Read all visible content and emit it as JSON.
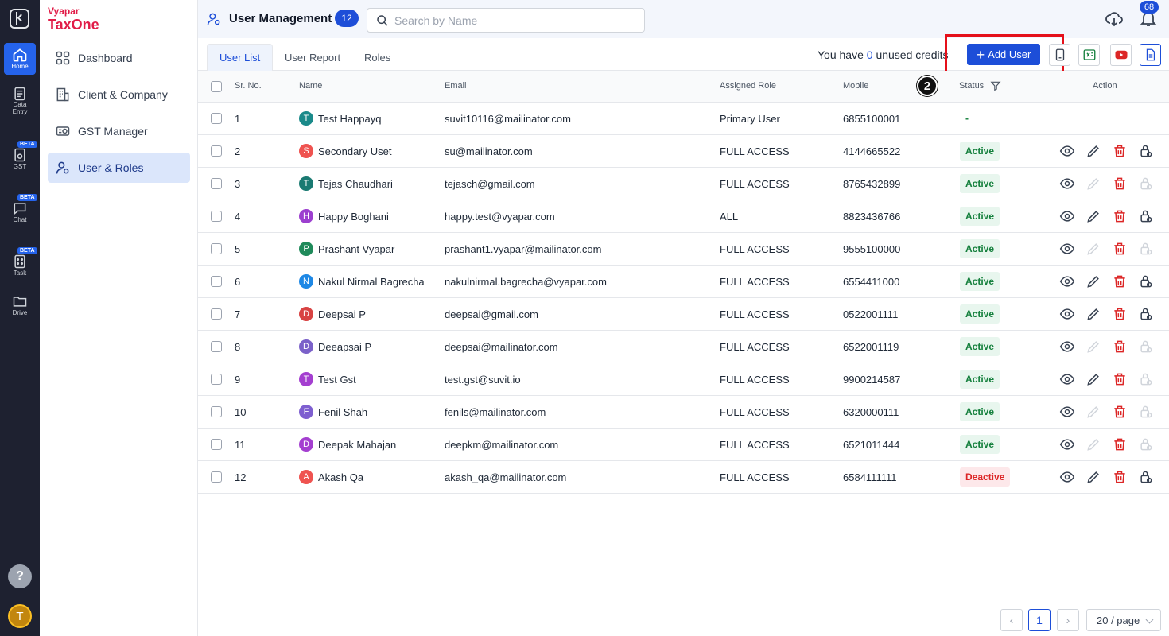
{
  "rail": {
    "items": [
      {
        "label": "Home",
        "icon": "home-icon"
      },
      {
        "label": "Data Entry",
        "icon": "data-entry-icon"
      },
      {
        "label": "GST",
        "icon": "gst-icon",
        "badge": "BETA"
      },
      {
        "label": "Chat",
        "icon": "chat-icon",
        "badge": "BETA"
      },
      {
        "label": "Task",
        "icon": "task-icon",
        "badge": "BETA"
      },
      {
        "label": "Drive",
        "icon": "drive-icon"
      }
    ],
    "help_label": "?",
    "user_initial": "T"
  },
  "logo": {
    "line1": "Vyapar",
    "line2": "TaxOne"
  },
  "sidebar": {
    "items": [
      {
        "label": "Dashboard"
      },
      {
        "label": "Client & Company"
      },
      {
        "label": "GST Manager"
      },
      {
        "label": "User & Roles"
      }
    ]
  },
  "header": {
    "title": "User Management",
    "count": "12",
    "search_placeholder": "Search by Name",
    "notification_count": "68"
  },
  "tabs": [
    {
      "label": "User List"
    },
    {
      "label": "User Report"
    },
    {
      "label": "Roles"
    }
  ],
  "credits": {
    "prefix": "You have",
    "count": "0",
    "suffix": "unused credits"
  },
  "add_user_label": "Add User",
  "step_marker": "2",
  "columns": {
    "sr": "Sr. No.",
    "name": "Name",
    "email": "Email",
    "role": "Assigned Role",
    "mobile": "Mobile",
    "status": "Status",
    "action": "Action"
  },
  "users": [
    {
      "sr": "1",
      "initial": "T",
      "name": "Test Happayq",
      "email": "suvit10116@mailinator.com",
      "role": "Primary User",
      "mobile": "6855100001",
      "status": "-",
      "status_type": "none",
      "color": "#1a8a8a",
      "actions": false
    },
    {
      "sr": "2",
      "initial": "S",
      "name": "Secondary Uset",
      "email": "su@mailinator.com",
      "role": "FULL ACCESS",
      "mobile": "4144665522",
      "status": "Active",
      "status_type": "active",
      "color": "#ef5350",
      "actions": true,
      "edit": true,
      "lock": true
    },
    {
      "sr": "3",
      "initial": "T",
      "name": "Tejas Chaudhari",
      "email": "tejasch@gmail.com",
      "role": "FULL ACCESS",
      "mobile": "8765432899",
      "status": "Active",
      "status_type": "active",
      "color": "#1a7a72",
      "actions": true,
      "edit": false,
      "lock": false
    },
    {
      "sr": "4",
      "initial": "H",
      "name": "Happy Boghani",
      "email": "happy.test@vyapar.com",
      "role": "ALL",
      "mobile": "8823436766",
      "status": "Active",
      "status_type": "active",
      "color": "#9c3fcf",
      "actions": true,
      "edit": true,
      "lock": true
    },
    {
      "sr": "5",
      "initial": "P",
      "name": "Prashant Vyapar",
      "email": "prashant1.vyapar@mailinator.com",
      "role": "FULL ACCESS",
      "mobile": "9555100000",
      "status": "Active",
      "status_type": "active",
      "color": "#1f8a5a",
      "actions": true,
      "edit": false,
      "lock": false
    },
    {
      "sr": "6",
      "initial": "N",
      "name": "Nakul Nirmal Bagrecha",
      "email": "nakulnirmal.bagrecha@vyapar.com",
      "role": "FULL ACCESS",
      "mobile": "6554411000",
      "status": "Active",
      "status_type": "active",
      "color": "#1e88e5",
      "actions": true,
      "edit": true,
      "lock": true
    },
    {
      "sr": "7",
      "initial": "D",
      "name": "Deepsai P",
      "email": "deepsai@gmail.com",
      "role": "FULL ACCESS",
      "mobile": "0522001111",
      "status": "Active",
      "status_type": "active",
      "color": "#d84343",
      "actions": true,
      "edit": true,
      "lock": true
    },
    {
      "sr": "8",
      "initial": "D",
      "name": "Deeapsai P",
      "email": "deepsai@mailinator.com",
      "role": "FULL ACCESS",
      "mobile": "6522001119",
      "status": "Active",
      "status_type": "active",
      "color": "#7b61c9",
      "actions": true,
      "edit": false,
      "lock": false
    },
    {
      "sr": "9",
      "initial": "T",
      "name": "Test Gst",
      "email": "test.gst@suvit.io",
      "role": "FULL ACCESS",
      "mobile": "9900214587",
      "status": "Active",
      "status_type": "active",
      "color": "#a43fd0",
      "actions": true,
      "edit": true,
      "lock": false
    },
    {
      "sr": "10",
      "initial": "F",
      "name": "Fenil Shah",
      "email": "fenils@mailinator.com",
      "role": "FULL ACCESS",
      "mobile": "6320000111",
      "status": "Active",
      "status_type": "active",
      "color": "#7e5fd0",
      "actions": true,
      "edit": false,
      "lock": false
    },
    {
      "sr": "11",
      "initial": "D",
      "name": "Deepak Mahajan",
      "email": "deepkm@mailinator.com",
      "role": "FULL ACCESS",
      "mobile": "6521011444",
      "status": "Active",
      "status_type": "active",
      "color": "#a43fd0",
      "actions": true,
      "edit": false,
      "lock": false
    },
    {
      "sr": "12",
      "initial": "A",
      "name": "Akash Qa",
      "email": "akash_qa@mailinator.com",
      "role": "FULL ACCESS",
      "mobile": "6584111111",
      "status": "Deactive",
      "status_type": "deactive",
      "color": "#ef5350",
      "actions": true,
      "edit": true,
      "lock": true
    }
  ],
  "pagination": {
    "prev": "‹",
    "current": "1",
    "next": "›",
    "page_size": "20 / page"
  }
}
